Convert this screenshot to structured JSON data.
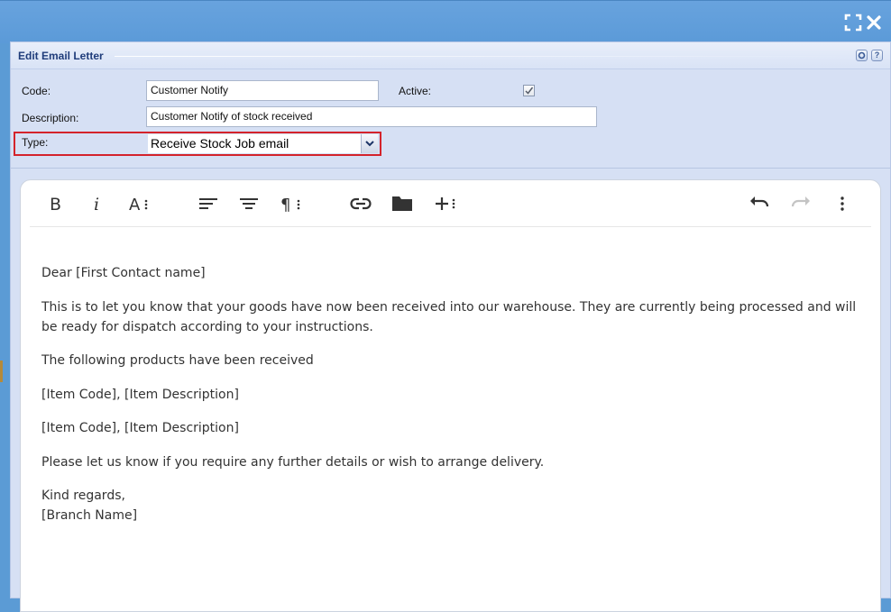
{
  "window": {
    "maximize_icon": "maximize-icon",
    "close_icon": "close-icon"
  },
  "panel": {
    "title": "Edit Email Letter",
    "settings_icon": "settings-icon",
    "help_label": "?"
  },
  "form": {
    "code_label": "Code:",
    "code_value": "Customer Notify",
    "active_label": "Active:",
    "active_checked": true,
    "description_label": "Description:",
    "description_value": "Customer Notify of stock received",
    "type_label": "Type:",
    "type_value": "Receive Stock Job email",
    "highlight_color": "#d4232b"
  },
  "editor": {
    "toolbar_icons": [
      "bold-icon",
      "italic-icon",
      "font-size-icon",
      "align-icon",
      "paragraph-format-icon",
      "paragraph-style-icon",
      "link-icon",
      "folder-icon",
      "insert-more-icon",
      "undo-icon",
      "redo-icon",
      "more-options-icon"
    ],
    "paragraphs": [
      "Dear [First Contact name]",
      "This is to let you know that your goods have now been received into our warehouse. They are currently being processed and will be ready for dispatch according to your instructions.",
      "The following products have been received",
      "[Item Code], [Item Description]",
      "[Item Code], [Item Description]",
      "Please let us know if you require any further details or wish to arrange delivery."
    ],
    "closing": [
      "Kind regards,",
      "[Branch Name]"
    ]
  }
}
